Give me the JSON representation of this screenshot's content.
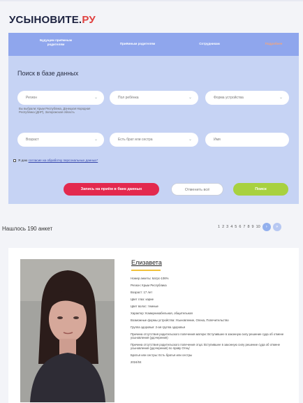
{
  "header": {
    "logo_main": "УСЫНОВИТЕ.",
    "logo_accent": "РУ"
  },
  "nav": {
    "items": [
      "Будущим приёмным родителям",
      "Приёмным родителям",
      "Сотрудникам",
      "Подробнее"
    ]
  },
  "search": {
    "title": "Поиск в базе данных",
    "fields": {
      "region": "Регион",
      "gender": "Пол ребёнка",
      "placement_form": "Форма устройства",
      "age": "Возраст",
      "siblings": "Есть брат или сестра",
      "name": "Имя"
    },
    "region_hint": "Вы выбрали: Крым Республика, Донецкая Народная Республика (ДНР), Запорожская область",
    "consent_prefix": "Я даю ",
    "consent_link": "согласие на обработку персональных данных*",
    "buttons": {
      "appointment": "Запись на приём в банк данных",
      "reset": "Отменить всё",
      "search": "Поиск"
    }
  },
  "results": {
    "count_text": "Нашлось 190 анкет",
    "pages": [
      "1",
      "2",
      "3",
      "4",
      "5",
      "6",
      "7",
      "8",
      "9",
      "10"
    ]
  },
  "profile": {
    "name": "Елизавета",
    "facts": [
      "Номер анкеты: 6атрс-106%",
      "Регион: Крым Республика",
      "Возраст: 17 лет",
      "Цвет глаз: карие",
      "Цвет волос: темные",
      "Характер: Коммуникабельная, общительная",
      "Возможные формы устройства: Усыновление, Опека, Попечительство",
      "Группа здоровья: 2-ая группа здоровья",
      "Причина отсутствия родительского попечения матери: Вступившее в законную силу решение суда об отмене усыновления (удочерения)",
      "Причина отсутствия родительского попечения отца: Вступившее в законную силу решение суда об отмене усыновления (удочерения) по праву Отец/",
      "Братья или сестры: Есть братья или сестры",
      "2024/04"
    ]
  },
  "colors": {
    "nav": "#8fa6ed",
    "panel": "#c6d3f4",
    "primary_button": "#e3294e",
    "search_button": "#a8d13f",
    "logo_accent": "#e0403f"
  }
}
